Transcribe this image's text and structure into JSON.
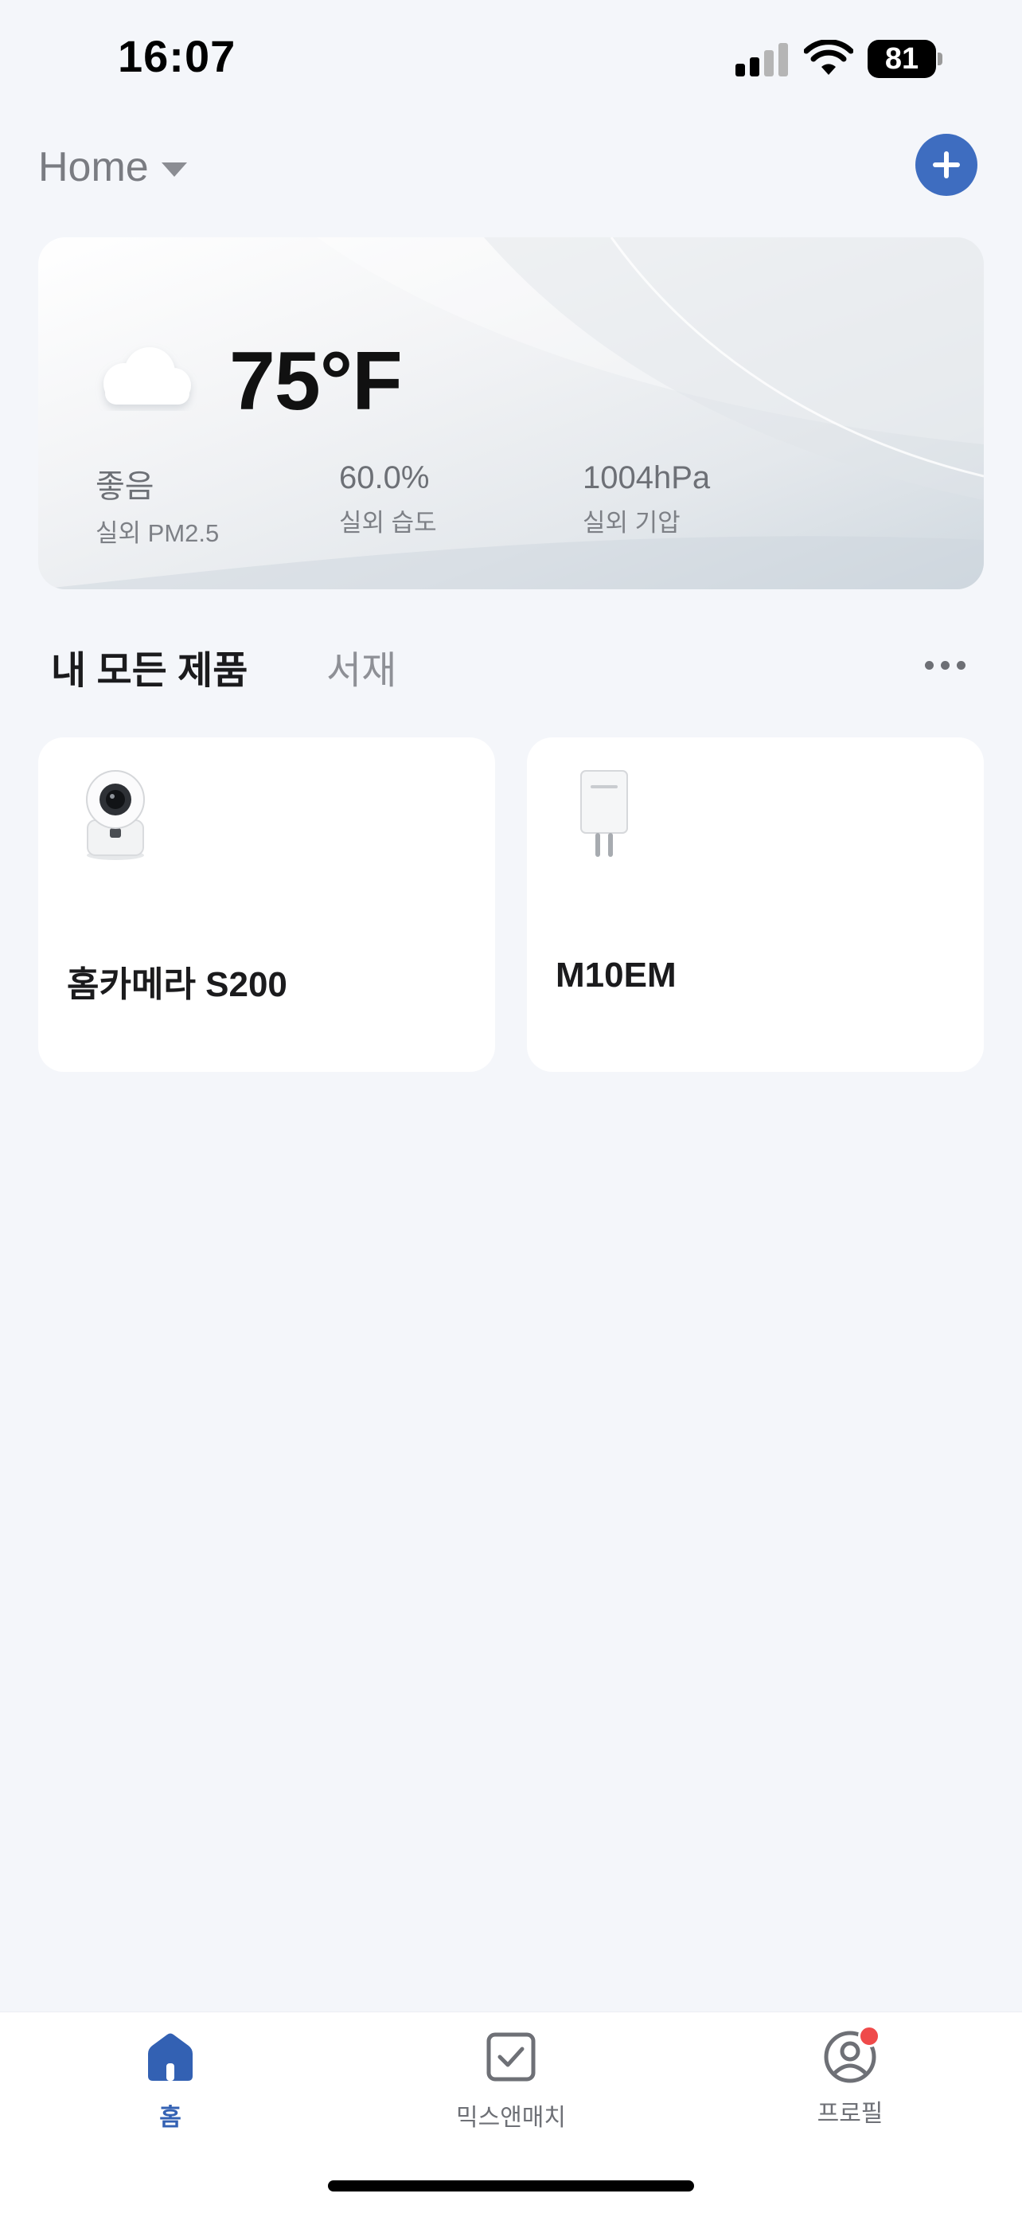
{
  "status_bar": {
    "time": "16:07",
    "battery": "81"
  },
  "header": {
    "home_title": "Home"
  },
  "weather": {
    "temperature": "75°F",
    "stats": [
      {
        "value": "좋음",
        "label": "실외 PM2.5"
      },
      {
        "value": "60.0%",
        "label": "실외 습도"
      },
      {
        "value": "1004hPa",
        "label": "실외 기압"
      }
    ]
  },
  "tabs": {
    "active": "내 모든 제품",
    "inactive": "서재"
  },
  "devices": [
    {
      "name": "홈카메라 S200",
      "icon": "security-camera-icon"
    },
    {
      "name": "M10EM",
      "icon": "smart-plug-icon"
    }
  ],
  "bottom_nav": [
    {
      "label": "홈",
      "icon": "home-icon",
      "active": true
    },
    {
      "label": "믹스앤매치",
      "icon": "checkbox-icon",
      "active": false
    },
    {
      "label": "프로필",
      "icon": "profile-icon",
      "active": false
    }
  ],
  "colors": {
    "accent": "#3e6dc0",
    "background": "#f4f6fa",
    "badge": "#ef4a4a"
  }
}
